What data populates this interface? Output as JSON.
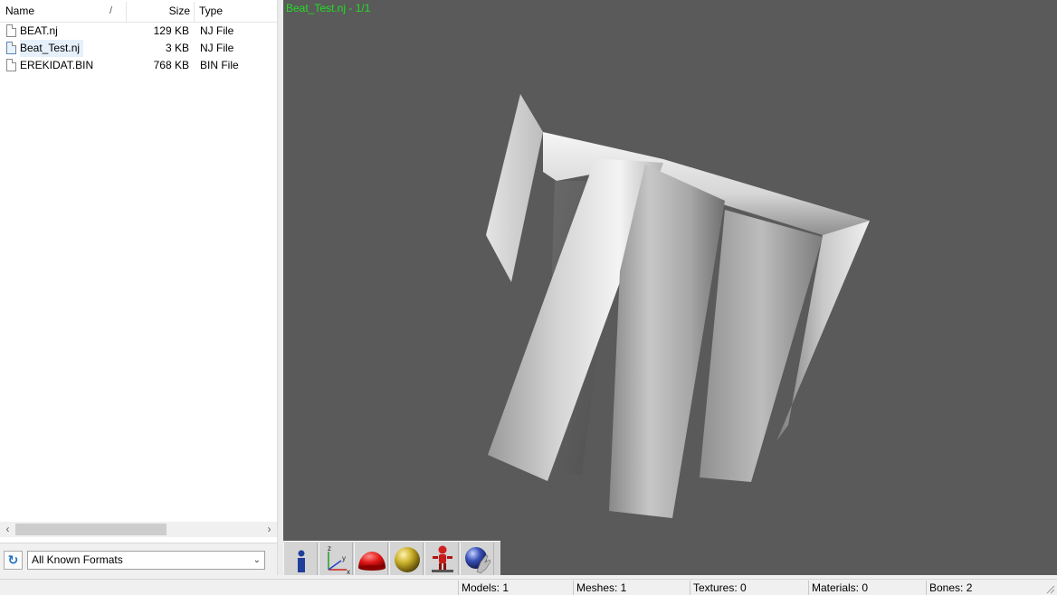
{
  "file_list": {
    "columns": {
      "name": "Name",
      "size": "Size",
      "type": "Type",
      "sort_glyph": "/"
    },
    "rows": [
      {
        "name": "BEAT.nj",
        "size": "129 KB",
        "type": "NJ File",
        "selected": false
      },
      {
        "name": "Beat_Test.nj",
        "size": "3 KB",
        "type": "NJ File",
        "selected": true
      },
      {
        "name": "EREKIDAT.BIN",
        "size": "768 KB",
        "type": "BIN File",
        "selected": false
      }
    ]
  },
  "scrollbar": {
    "left_arrow": "‹",
    "right_arrow": "›"
  },
  "filter": {
    "refresh_glyph": "↻",
    "selected_format": "All Known Formats",
    "chevron": "⌄"
  },
  "viewport": {
    "model_label": "Beat_Test.nj - 1/1",
    "label_color": "#22dd22",
    "background": "#5a5a5a"
  },
  "toolbar": {
    "buttons": [
      "info-icon",
      "axes-icon",
      "red-hemisphere-icon",
      "gold-sphere-icon",
      "skeleton-figure-icon",
      "blue-sphere-hand-icon"
    ],
    "axis_labels": {
      "z": "z",
      "y": "y",
      "x": "x"
    },
    "info_glyph": "i"
  },
  "status": {
    "models": "Models: 1",
    "meshes": "Meshes: 1",
    "textures": "Textures: 0",
    "materials": "Materials: 0",
    "bones": "Bones: 2"
  }
}
